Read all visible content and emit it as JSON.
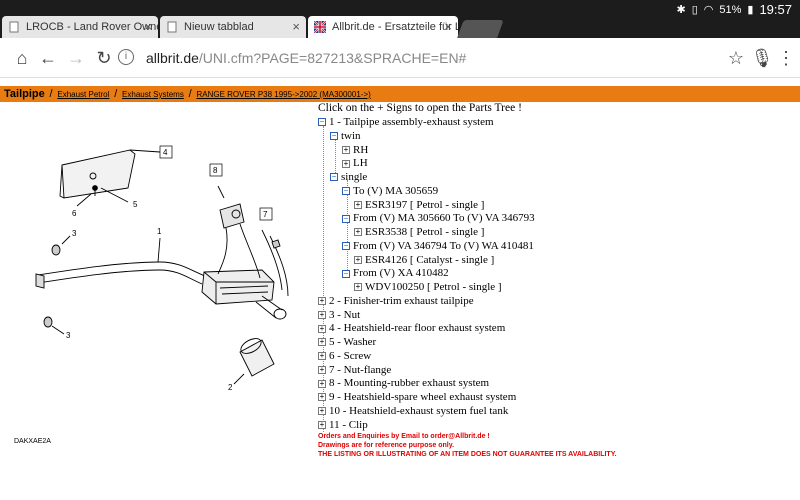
{
  "status_bar": {
    "battery": "51%",
    "clock": "19:57"
  },
  "tabs": [
    {
      "title": "LROCB - Land Rover Owners",
      "close": "×"
    },
    {
      "title": "Nieuw tabblad",
      "close": "×"
    },
    {
      "title": "Allbrit.de - Ersatzteile für LAN",
      "close": "×"
    }
  ],
  "toolbar": {
    "url_domain": "allbrit.de",
    "url_path": "/UNI.cfm?PAGE=827213&SPRACHE=EN#"
  },
  "breadcrumb": {
    "current": "Tailpipe",
    "links": [
      "Exhaust Petrol",
      "Exhaust Systems",
      "RANGE ROVER P38 1995->2002 (MA300001->)"
    ]
  },
  "diagram": {
    "code": "DAKXAE2A",
    "callouts": [
      "1",
      "2",
      "3",
      "3",
      "4",
      "5",
      "6",
      "7",
      "8"
    ]
  },
  "tree": {
    "intro": "Click on the + Signs to open the Parts Tree !",
    "nodes": [
      {
        "label": "1 - Tailpipe assembly-exhaust system",
        "toggle": "−"
      },
      {
        "label": "twin",
        "toggle": "−"
      },
      {
        "label": "RH",
        "toggle": "+"
      },
      {
        "label": "LH",
        "toggle": "+"
      },
      {
        "label": "single",
        "toggle": "−"
      },
      {
        "label": "To (V) MA 305659",
        "toggle": "−"
      },
      {
        "label": "ESR3197 [ Petrol - single ]",
        "toggle": "+"
      },
      {
        "label": "From (V) MA 305660 To (V) VA 346793",
        "toggle": "−"
      },
      {
        "label": "ESR3538 [ Petrol - single ]",
        "toggle": "+"
      },
      {
        "label": "From (V) VA 346794 To (V) WA 410481",
        "toggle": "−"
      },
      {
        "label": "ESR4126 [ Catalyst - single ]",
        "toggle": "+"
      },
      {
        "label": "From (V) XA 410482",
        "toggle": "−"
      },
      {
        "label": "WDV100250 [ Petrol - single ]",
        "toggle": "+"
      },
      {
        "label": "2 - Finisher-trim exhaust tailpipe",
        "toggle": "+"
      },
      {
        "label": "3 - Nut",
        "toggle": "+"
      },
      {
        "label": "4 - Heatshield-rear floor exhaust system",
        "toggle": "+"
      },
      {
        "label": "5 - Washer",
        "toggle": "+"
      },
      {
        "label": "6 - Screw",
        "toggle": "+"
      },
      {
        "label": "7 - Nut-flange",
        "toggle": "+"
      },
      {
        "label": "8 - Mounting-rubber exhaust system",
        "toggle": "+"
      },
      {
        "label": "9 - Heatshield-spare wheel exhaust system",
        "toggle": "+"
      },
      {
        "label": "10 - Heatshield-exhaust system fuel tank",
        "toggle": "+"
      },
      {
        "label": "11 - Clip",
        "toggle": "+"
      }
    ]
  },
  "footer": {
    "line1": "Orders and Enquiries by Email to order@Allbrit.de !",
    "line2": "Drawings are for reference purpose only.",
    "line3": "THE LISTING OR ILLUSTRATING OF AN ITEM DOES NOT GUARANTEE ITS AVAILABILITY."
  }
}
